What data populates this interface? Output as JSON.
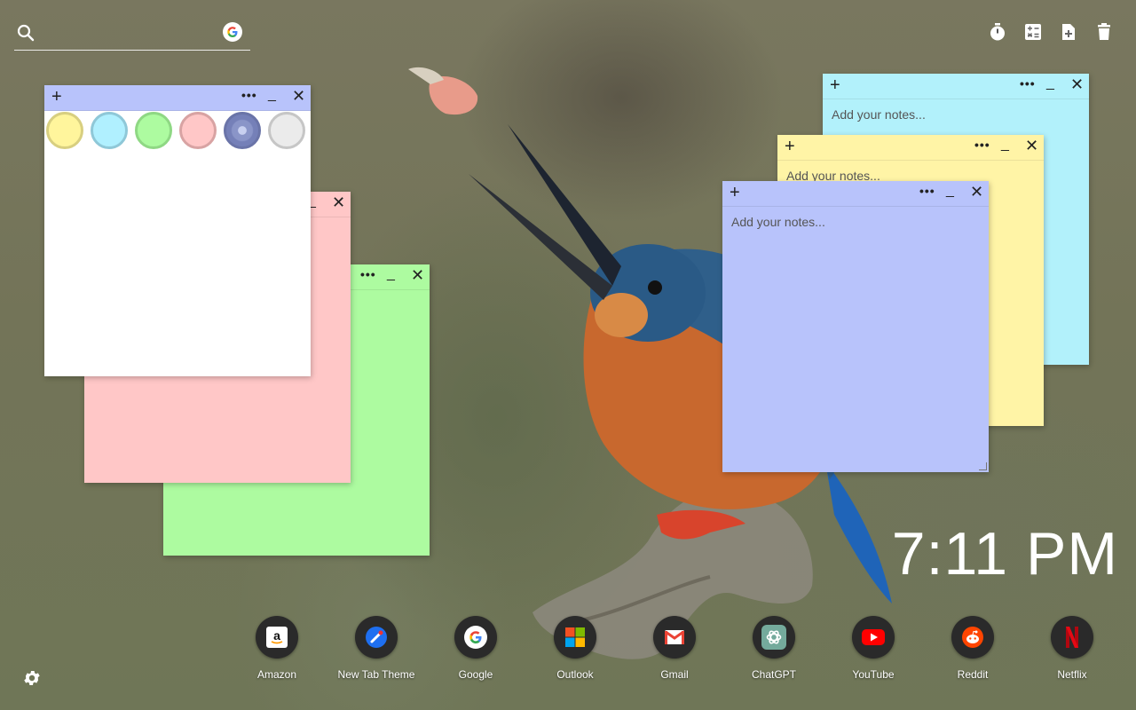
{
  "search": {
    "value": "",
    "placeholder": "",
    "search_icon": "search-icon",
    "engine_icon": "google-g-icon"
  },
  "toolbar": {
    "items": [
      {
        "icon": "timer-icon"
      },
      {
        "icon": "calculator-icon"
      },
      {
        "icon": "add-note-icon"
      },
      {
        "icon": "trash-icon"
      }
    ]
  },
  "notes": [
    {
      "color": "#adfba0",
      "placeholder": "",
      "controls": {
        "more": "•••",
        "minimize": "_",
        "close": "✕"
      }
    },
    {
      "color": "#ffc7c7",
      "placeholder": "",
      "controls": {
        "minimize": "_",
        "close": "✕"
      }
    },
    {
      "color": "#ffffff",
      "placeholder": "",
      "controls": {
        "add": "+",
        "more": "•••",
        "minimize": "_",
        "close": "✕"
      },
      "color_picker": [
        "#fff59c",
        "#b0f0ff",
        "#adfba0",
        "#ffc7c7",
        "#95a0d4",
        "#ebebeb"
      ]
    },
    {
      "color": "#b2f1fb",
      "placeholder": "Add your notes...",
      "controls": {
        "add": "+",
        "more": "•••",
        "minimize": "_",
        "close": "✕"
      }
    },
    {
      "color": "#fff4a6",
      "placeholder": "Add your notes...",
      "controls": {
        "add": "+",
        "more": "•••",
        "minimize": "_",
        "close": "✕"
      }
    },
    {
      "color": "#b8c3fb",
      "placeholder": "Add your notes...",
      "controls": {
        "add": "+",
        "more": "•••",
        "minimize": "_",
        "close": "✕"
      }
    }
  ],
  "clock": {
    "time": "7:11 PM"
  },
  "dock": [
    {
      "label": "Amazon",
      "icon": "amazon-icon"
    },
    {
      "label": "New Tab Theme",
      "icon": "new-tab-theme-icon"
    },
    {
      "label": "Google",
      "icon": "google-icon"
    },
    {
      "label": "Outlook",
      "icon": "microsoft-icon"
    },
    {
      "label": "Gmail",
      "icon": "gmail-icon"
    },
    {
      "label": "ChatGPT",
      "icon": "chatgpt-icon"
    },
    {
      "label": "YouTube",
      "icon": "youtube-icon"
    },
    {
      "label": "Reddit",
      "icon": "reddit-icon"
    },
    {
      "label": "Netflix",
      "icon": "netflix-icon"
    }
  ],
  "settings": {
    "icon": "gear-icon"
  },
  "background": {
    "subject": "kingfisher bird on branch"
  }
}
